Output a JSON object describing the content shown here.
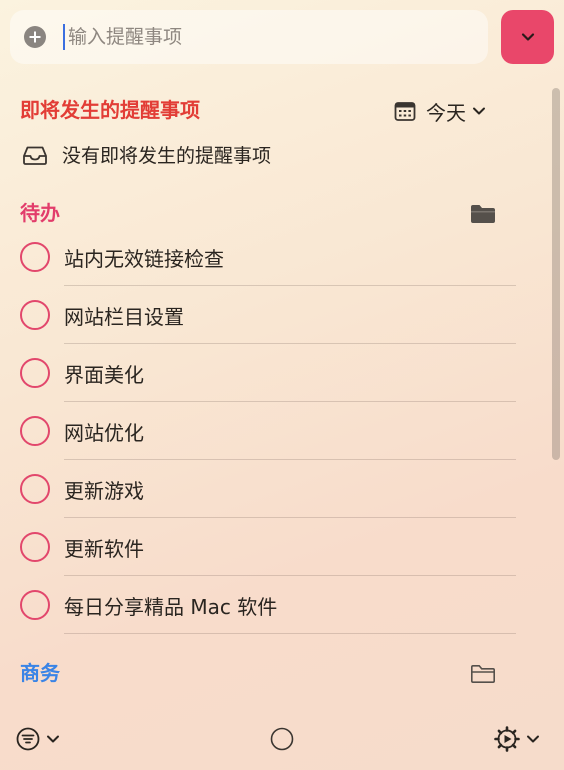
{
  "search": {
    "placeholder": "输入提醒事项"
  },
  "upcoming": {
    "title": "即将发生的提醒事项",
    "date_label": "今天",
    "empty_text": "没有即将发生的提醒事项"
  },
  "todo": {
    "title": "待办",
    "items": [
      {
        "label": "站内无效链接检查"
      },
      {
        "label": "网站栏目设置"
      },
      {
        "label": "界面美化"
      },
      {
        "label": "网站优化"
      },
      {
        "label": "更新游戏"
      },
      {
        "label": "更新软件"
      },
      {
        "label": "每日分享精品 Mac 软件"
      }
    ]
  },
  "business": {
    "title": "商务"
  },
  "colors": {
    "accent": "#e9476a",
    "upcoming": "#e23d36",
    "todo": "#e23d6b",
    "business": "#3a84e6"
  },
  "icons": [
    "plus-circle-icon",
    "chevron-down-icon",
    "calendar-icon",
    "inbox-tray-icon",
    "folder-icon",
    "filter-icon",
    "circle-icon",
    "gear-icon"
  ]
}
